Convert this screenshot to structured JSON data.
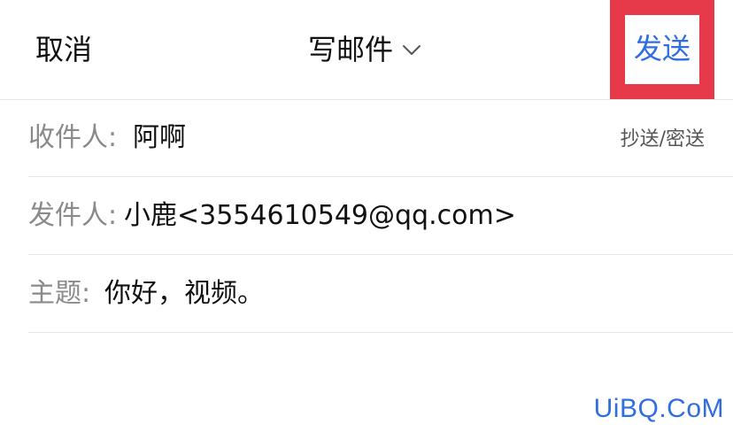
{
  "nav": {
    "cancel_label": "取消",
    "title": "写邮件",
    "send_label": "发送",
    "send_color": "#2f6ee0",
    "highlight_color": "#e63a4b"
  },
  "fields": {
    "to": {
      "label": "收件人:",
      "value": "阿啊",
      "cc_bcc_label": "抄送/密送"
    },
    "from": {
      "label": "发件人:",
      "value": "小鹿<3554610549@qq.com>"
    },
    "subject": {
      "label": "主题:",
      "value": "你好，视频。"
    }
  },
  "watermark": "UiBQ.CoM"
}
